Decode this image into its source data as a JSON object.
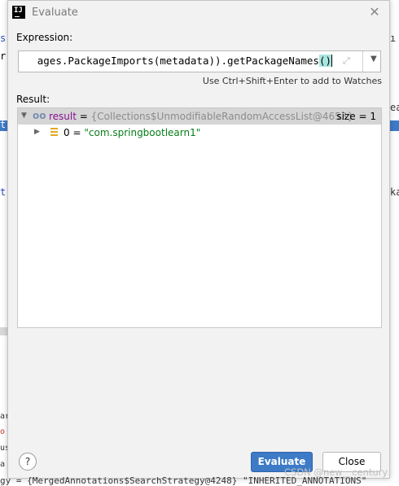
{
  "dialog": {
    "title": "Evaluate",
    "expression_label": "Expression:",
    "expression": {
      "visible_text": "ages.PackageImports(metadata)).getPackageNames",
      "highlighted_parens": "()"
    },
    "hint": "Use Ctrl+Shift+Enter to add to Watches",
    "result_label": "Result:",
    "result_tree": {
      "root": {
        "name": "result",
        "equals": "=",
        "type": "{Collections$UnmodifiableRandomAccessList@4653}",
        "size": "size = 1"
      },
      "children": [
        {
          "name": "0",
          "equals": "=",
          "value": "\"com.springbootlearn1\""
        }
      ]
    },
    "buttons": {
      "help": "?",
      "evaluate": "Evaluate",
      "close": "Close"
    }
  },
  "background": {
    "left_fragments": [
      "s",
      "r",
      "t",
      "t",
      "ar",
      "o",
      "us",
      "a"
    ],
    "right_fragments": [
      "ı",
      "ea",
      "ka"
    ],
    "bottom_code": "gy = {MergedAnnotations$SearchStrategy@4248} \"INHERITED_ANNOTATIONS\""
  },
  "watermark": "CSDN @new__century",
  "colors": {
    "accent_button": "#3d7bc7",
    "var_name": "#871094",
    "string_value": "#067d17",
    "type_text": "#8c8c8c",
    "selection_row": "#d5d5d5",
    "paren_highlight": "#a8e6e0"
  }
}
